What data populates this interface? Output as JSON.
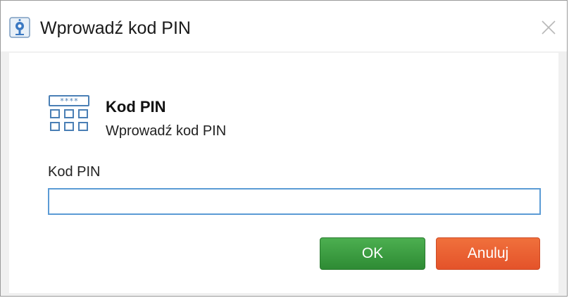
{
  "window": {
    "title": "Wprowadź kod PIN"
  },
  "header": {
    "title": "Kod PIN",
    "subtitle": "Wprowadź kod PIN",
    "icon": "pin-keypad-icon"
  },
  "form": {
    "pin_label": "Kod PIN",
    "pin_value": ""
  },
  "buttons": {
    "ok_label": "OK",
    "cancel_label": "Anuluj"
  },
  "colors": {
    "ok_button": "#3a9d40",
    "cancel_button": "#ea5f30",
    "input_border": "#5b9bd5",
    "icon_blue": "#4a7fb5"
  }
}
